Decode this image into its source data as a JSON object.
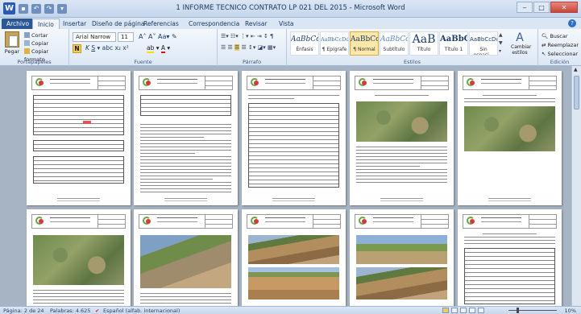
{
  "window": {
    "title": "1 INFORME TECNICO CONTRATO LP 021 DEL 2015 - Microsoft Word",
    "logo": "W",
    "controls": {
      "minimize": "‒",
      "maximize": "□",
      "close": "✕"
    }
  },
  "tabs": [
    "Archivo",
    "Inicio",
    "Insertar",
    "Diseño de página",
    "Referencias",
    "Correspondencia",
    "Revisar",
    "Vista"
  ],
  "ribbon": {
    "clipboard": {
      "paste": "Pegar",
      "cut": "Cortar",
      "copy": "Copiar",
      "format_painter": "Copiar formato",
      "label": "Portapapeles"
    },
    "font": {
      "name": "Arial Narrow",
      "size": "11",
      "label": "Fuente"
    },
    "paragraph": {
      "label": "Párrafo"
    },
    "styles": {
      "label": "Estilos",
      "items": [
        {
          "preview": "AaBbCcI",
          "name": "Énfasis"
        },
        {
          "preview": "AaBbCcDdI",
          "name": "¶ Epígrafe"
        },
        {
          "preview": "AaBbCcI",
          "name": "¶ Normal"
        },
        {
          "preview": "AaBbCc",
          "name": "Subtítulo"
        },
        {
          "preview": "AaB",
          "name": "Título"
        },
        {
          "preview": "AaBbC",
          "name": "Título 1"
        },
        {
          "preview": "AaBbCcDc",
          "name": "Sin espaci..."
        }
      ],
      "change": "Cambiar estilos"
    },
    "editing": {
      "label": "Edición",
      "find": "Buscar",
      "replace": "Reemplazar",
      "select": "Seleccionar"
    }
  },
  "status": {
    "page": "Página: 2 de 24",
    "words": "Palabras: 4.625",
    "language": "Español (alfab. internacional)",
    "zoom": "10%"
  },
  "colors": {
    "file_tab": "#2b5797",
    "highlight": "#f5cb5c",
    "logo_green": "#6aa444",
    "logo_red": "#d23b3b"
  }
}
